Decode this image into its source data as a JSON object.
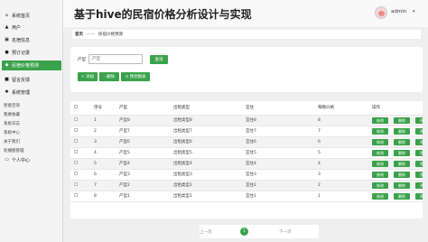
{
  "sidebar": {
    "items": [
      {
        "label": "系统首页",
        "icon": "home-icon",
        "glyph": "⌂"
      },
      {
        "label": "用户",
        "icon": "user-icon",
        "glyph": "▲"
      },
      {
        "label": "名宿信息",
        "icon": "building-icon",
        "glyph": "▣"
      },
      {
        "label": "预订记录",
        "icon": "reservation-icon",
        "glyph": "●"
      },
      {
        "label": "民宿价格预测",
        "icon": "prediction-icon",
        "glyph": "◆"
      },
      {
        "label": "留言反馈",
        "icon": "message-icon",
        "glyph": "■"
      },
      {
        "label": "系统管理",
        "icon": "gear-icon",
        "glyph": "✱"
      }
    ],
    "sub_items": [
      "智能咨询",
      "我要收藏",
      "系统日志",
      "系统中心",
      "关于我们",
      "轮播图管理"
    ],
    "personal": {
      "label": "个人中心",
      "glyph": "▭"
    }
  },
  "header": {
    "title": "基于hive的民宿价格分析设计与实现",
    "user": "admin",
    "caret": "▾"
  },
  "breadcrumb": {
    "home": "首页",
    "separator": "——",
    "current": "民宿价格预测"
  },
  "search": {
    "label": "产型",
    "placeholder": "产型",
    "search_button": "查询",
    "add_button": "+ 添加",
    "delete_button": "- 删除",
    "predict_button": "⊙ 预测图表"
  },
  "table": {
    "headers": [
      "",
      "序号",
      "产型",
      "出租类型",
      "宜住",
      "每晚价格",
      "操作"
    ],
    "rows": [
      {
        "idx": "1",
        "type": "产型8",
        "rent": "出租类型8",
        "live": "宜住8",
        "price": "8"
      },
      {
        "idx": "2",
        "type": "产型7",
        "rent": "出租类型7",
        "live": "宜住7",
        "price": "7"
      },
      {
        "idx": "3",
        "type": "产型6",
        "rent": "出租类型6",
        "live": "宜住6",
        "price": "6"
      },
      {
        "idx": "4",
        "type": "产型5",
        "rent": "出租类型5",
        "live": "宜住5",
        "price": "5"
      },
      {
        "idx": "5",
        "type": "产型4",
        "rent": "出租类型4",
        "live": "宜住4",
        "price": "4"
      },
      {
        "idx": "6",
        "type": "产型3",
        "rent": "出租类型3",
        "live": "宜住3",
        "price": "3"
      },
      {
        "idx": "7",
        "type": "产型2",
        "rent": "出租类型2",
        "live": "宜住2",
        "price": "2"
      },
      {
        "idx": "8",
        "type": "产型1",
        "rent": "出租类型1",
        "live": "宜住1",
        "price": "1"
      }
    ],
    "ops": [
      "修改",
      "删除",
      "预测"
    ]
  },
  "pager": {
    "prev": "上一页",
    "current": "1",
    "next": "下一页"
  },
  "colors": {
    "accent": "#3aa24a"
  }
}
